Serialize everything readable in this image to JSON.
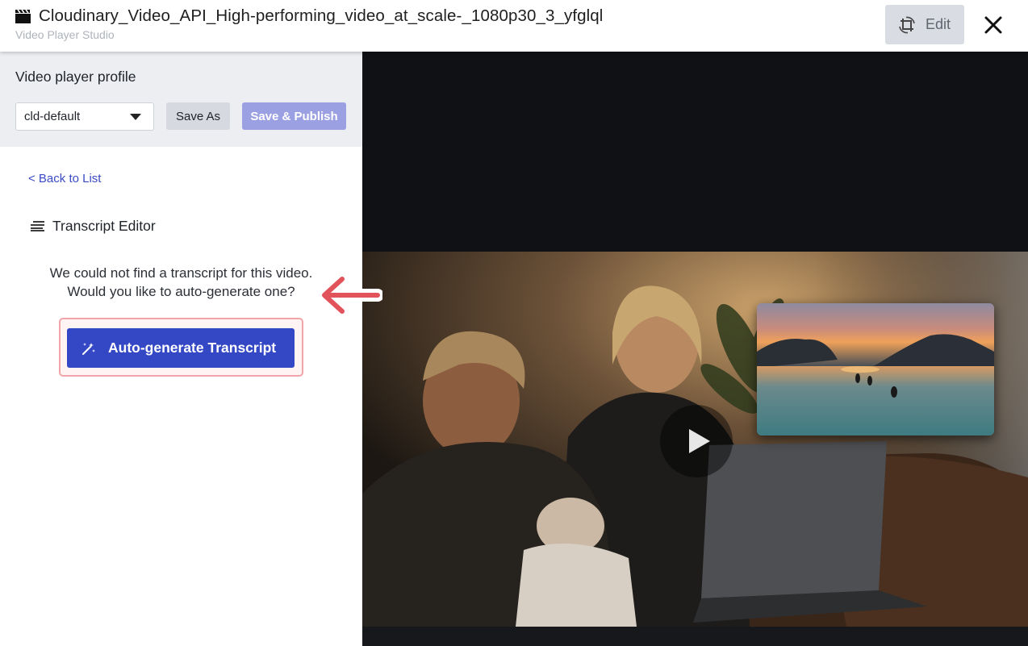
{
  "header": {
    "title": "Cloudinary_Video_API_High-performing_video_at_scale-_1080p30_3_yfglql",
    "subtitle": "Video Player Studio",
    "edit_label": "Edit",
    "clapper_icon": "clapperboard-icon",
    "edit_icon": "crop-rotate-icon",
    "close_icon": "close-icon"
  },
  "profile": {
    "label": "Video player profile",
    "selected_value": "cld-default",
    "save_as_label": "Save As",
    "save_publish_label": "Save & Publish"
  },
  "transcript": {
    "back_label": "< Back to List",
    "heading": "Transcript Editor",
    "message_line1": "We could not find a transcript for this video.",
    "message_line2": "Would you like to auto-generate one?",
    "autogen_label": "Auto-generate Transcript",
    "heading_icon": "text-lines-icon",
    "autogen_icon": "magic-wand-icon"
  },
  "video": {
    "play_icon": "play-icon",
    "pip_description_icon": "video-thumbnail"
  },
  "colors": {
    "accent": "#3448c5",
    "accent_disabled": "#9ba0e2",
    "highlight_border": "#f0a5a8",
    "arrow": "#e2525a",
    "link": "#3a4bc4"
  }
}
